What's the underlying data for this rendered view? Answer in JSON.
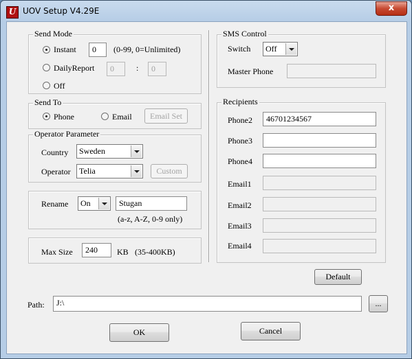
{
  "window": {
    "title": "UOV Setup V4.29E",
    "close_label": "x"
  },
  "send_mode": {
    "legend": "Send Mode",
    "instant": {
      "label": "Instant",
      "value": "0",
      "hint": "(0-99, 0=Unlimited)",
      "selected": true
    },
    "daily_report": {
      "label": "DailyReport",
      "value1": "0",
      "separator": ":",
      "value2": "0"
    },
    "off": {
      "label": "Off"
    }
  },
  "send_to": {
    "legend": "Send To",
    "phone_label": "Phone",
    "email_label": "Email",
    "email_set_button": "Email Set"
  },
  "operator": {
    "legend": "Operator Parameter",
    "country_label": "Country",
    "country_value": "Sweden",
    "operator_label": "Operator",
    "operator_value": "Telia",
    "custom_button": "Custom"
  },
  "rename": {
    "label": "Rename",
    "mode_value": "On",
    "name_value": "Stugan",
    "hint": "(a-z, A-Z, 0-9 only)"
  },
  "max_size": {
    "label": "Max Size",
    "value": "240",
    "unit": "KB",
    "hint": "(35-400KB)"
  },
  "sms_control": {
    "legend": "SMS Control",
    "switch_label": "Switch",
    "switch_value": "Off",
    "master_phone_label": "Master Phone",
    "master_phone_value": ""
  },
  "recipients": {
    "legend": "Recipients",
    "fields": [
      {
        "label": "Phone2",
        "value": "46701234567"
      },
      {
        "label": "Phone3",
        "value": ""
      },
      {
        "label": "Phone4",
        "value": ""
      },
      {
        "label": "Email1",
        "value": ""
      },
      {
        "label": "Email2",
        "value": ""
      },
      {
        "label": "Email3",
        "value": ""
      },
      {
        "label": "Email4",
        "value": ""
      }
    ]
  },
  "default_button": "Default",
  "path": {
    "label": "Path:",
    "value": "J:\\",
    "browse_button": "..."
  },
  "ok_button": "OK",
  "cancel_button": "Cancel"
}
